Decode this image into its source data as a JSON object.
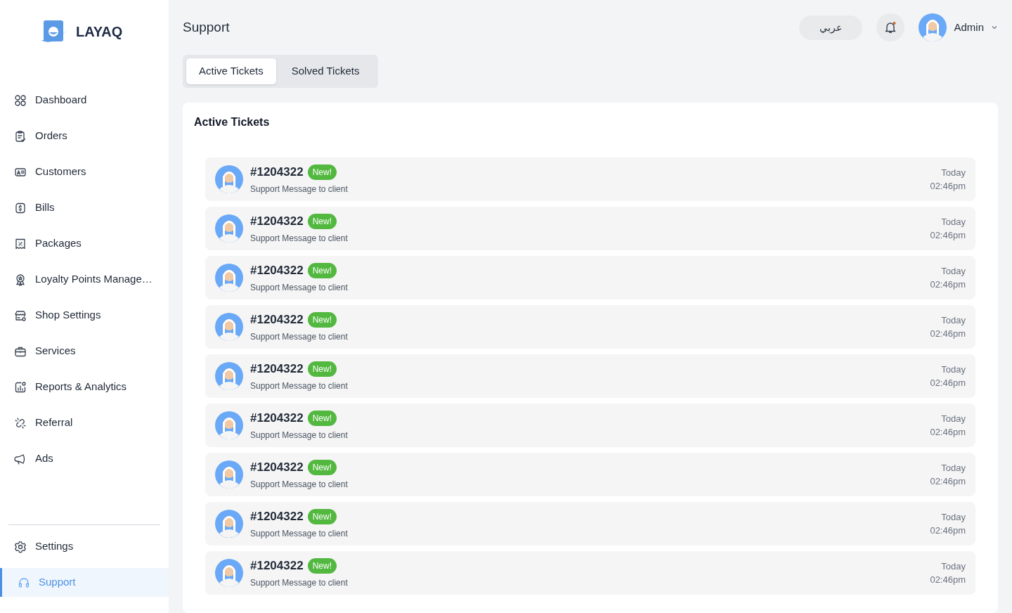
{
  "brand": "LAYAQ",
  "sidebar": {
    "items": [
      {
        "label": "Dashboard",
        "selected": false
      },
      {
        "label": "Orders",
        "selected": false
      },
      {
        "label": "Customers",
        "selected": false
      },
      {
        "label": "Bills",
        "selected": false
      },
      {
        "label": "Packages",
        "selected": false
      },
      {
        "label": "Loyalty Points Manage…",
        "selected": false
      },
      {
        "label": "Shop Settings",
        "selected": false
      },
      {
        "label": "Services",
        "selected": false
      },
      {
        "label": "Reports & Analytics",
        "selected": false
      },
      {
        "label": "Referral",
        "selected": false
      },
      {
        "label": "Ads",
        "selected": false
      }
    ],
    "bottom_items": [
      {
        "label": "Settings",
        "selected": false
      },
      {
        "label": "Support",
        "selected": true
      }
    ]
  },
  "header": {
    "title": "Support",
    "language_button": "عربي",
    "notification_unread": true,
    "user": "Admin"
  },
  "tabs": [
    {
      "label": "Active Tickets",
      "selected": true
    },
    {
      "label": "Solved Tickets",
      "selected": false
    }
  ],
  "panel": {
    "title": "Active Tickets",
    "tickets": [
      {
        "number": "#1204322",
        "badge": "New!",
        "message": "Support Message to client",
        "day": "Today",
        "time": "02:46pm"
      },
      {
        "number": "#1204322",
        "badge": "New!",
        "message": "Support Message to client",
        "day": "Today",
        "time": "02:46pm"
      },
      {
        "number": "#1204322",
        "badge": "New!",
        "message": "Support Message to client",
        "day": "Today",
        "time": "02:46pm"
      },
      {
        "number": "#1204322",
        "badge": "New!",
        "message": "Support Message to client",
        "day": "Today",
        "time": "02:46pm"
      },
      {
        "number": "#1204322",
        "badge": "New!",
        "message": "Support Message to client",
        "day": "Today",
        "time": "02:46pm"
      },
      {
        "number": "#1204322",
        "badge": "New!",
        "message": "Support Message to client",
        "day": "Today",
        "time": "02:46pm"
      },
      {
        "number": "#1204322",
        "badge": "New!",
        "message": "Support Message to client",
        "day": "Today",
        "time": "02:46pm"
      },
      {
        "number": "#1204322",
        "badge": "New!",
        "message": "Support Message to client",
        "day": "Today",
        "time": "02:46pm"
      },
      {
        "number": "#1204322",
        "badge": "New!",
        "message": "Support Message to client",
        "day": "Today",
        "time": "02:46pm"
      }
    ]
  }
}
